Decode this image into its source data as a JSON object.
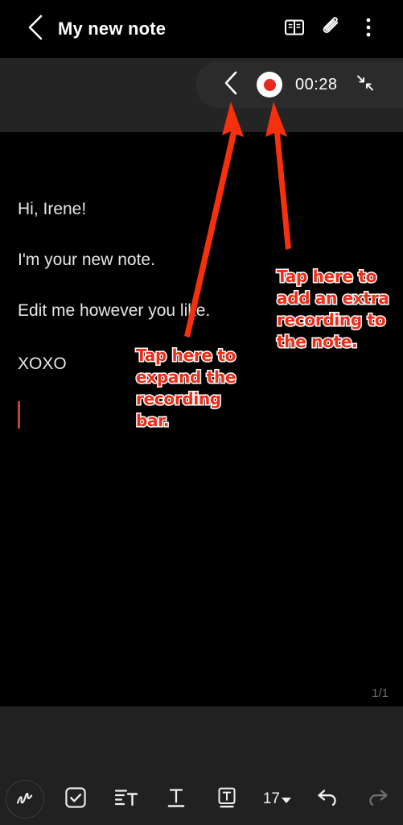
{
  "header": {
    "back_icon": "chevron-left-icon",
    "title": "My new note",
    "actions": [
      {
        "icon": "book-reading-mode-icon",
        "name": "reading-mode-button"
      },
      {
        "icon": "paperclip-attachment-icon",
        "name": "attachment-button"
      },
      {
        "icon": "more-vertical-icon",
        "name": "more-options-button"
      }
    ]
  },
  "recording_bar": {
    "collapse_back_icon": "chevron-left-icon",
    "record_icon": "record-dot-icon",
    "timer": "00:28",
    "minimize_icon": "collapse-arrows-icon"
  },
  "note": {
    "lines": [
      "Hi, Irene!",
      "I'm your new note.",
      "Edit me however you like.",
      "XOXO"
    ],
    "page_indicator": "1/1",
    "caret_color": "#c2452e"
  },
  "annotations": [
    {
      "name": "annotation-expand-recording-bar",
      "text": "Tap here to expand the recording bar.",
      "color": "#ef2d18",
      "outline": "#ffffff"
    },
    {
      "name": "annotation-add-extra-recording",
      "text": "Tap here to add an extra recording to the note.",
      "color": "#ef2d18",
      "outline": "#ffffff"
    }
  ],
  "arrows": {
    "color": "#f5300c",
    "items": [
      {
        "name": "arrow-to-collapse-back",
        "target": "recording-bar-back-chevron"
      },
      {
        "name": "arrow-to-record-button",
        "target": "recording-bar-record-button"
      }
    ]
  },
  "toolbar": {
    "items": [
      {
        "name": "handwriting-button",
        "icon": "pen-squiggle-icon",
        "label": ""
      },
      {
        "name": "checklist-button",
        "icon": "checkbox-icon",
        "label": ""
      },
      {
        "name": "paragraph-style-button",
        "icon": "text-align-icon",
        "label": ""
      },
      {
        "name": "text-format-button",
        "icon": "text-underline-t-icon",
        "label": ""
      },
      {
        "name": "text-box-button",
        "icon": "t-in-box-icon",
        "label": ""
      },
      {
        "name": "font-size-button",
        "icon": "chevron-down-icon",
        "label": "17"
      },
      {
        "name": "undo-button",
        "icon": "undo-arrow-icon",
        "label": ""
      },
      {
        "name": "redo-button",
        "icon": "redo-arrow-icon",
        "label": ""
      }
    ]
  },
  "colors": {
    "background": "#000000",
    "band": "#242424",
    "panel": "#212121",
    "accent_red": "#e8291f",
    "annotation_red": "#ef2d18",
    "muted_text": "#6b6b6b"
  }
}
